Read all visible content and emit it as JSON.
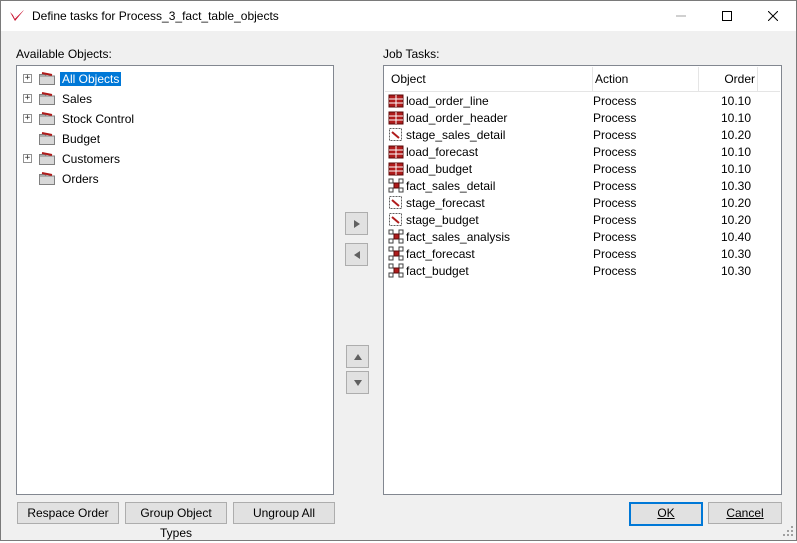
{
  "window": {
    "title": "Define tasks for Process_3_fact_table_objects"
  },
  "left_panel": {
    "label": "Available Objects:",
    "items": [
      {
        "label": "All Objects",
        "selected": true,
        "expandable": true
      },
      {
        "label": "Sales",
        "selected": false,
        "expandable": true
      },
      {
        "label": "Stock Control",
        "selected": false,
        "expandable": true
      },
      {
        "label": "Budget",
        "selected": false,
        "expandable": false
      },
      {
        "label": "Customers",
        "selected": false,
        "expandable": true
      },
      {
        "label": "Orders",
        "selected": false,
        "expandable": false
      }
    ]
  },
  "right_panel": {
    "label": "Job Tasks:",
    "columns": {
      "object": "Object",
      "action": "Action",
      "order": "Order"
    },
    "rows": [
      {
        "object": "load_order_line",
        "action": "Process",
        "order": "10.10",
        "icon": "load-table-icon"
      },
      {
        "object": "load_order_header",
        "action": "Process",
        "order": "10.10",
        "icon": "load-table-icon"
      },
      {
        "object": "stage_sales_detail",
        "action": "Process",
        "order": "10.20",
        "icon": "stage-table-icon"
      },
      {
        "object": "load_forecast",
        "action": "Process",
        "order": "10.10",
        "icon": "load-table-icon"
      },
      {
        "object": "load_budget",
        "action": "Process",
        "order": "10.10",
        "icon": "load-table-icon"
      },
      {
        "object": "fact_sales_detail",
        "action": "Process",
        "order": "10.30",
        "icon": "fact-table-icon"
      },
      {
        "object": "stage_forecast",
        "action": "Process",
        "order": "10.20",
        "icon": "stage-table-icon"
      },
      {
        "object": "stage_budget",
        "action": "Process",
        "order": "10.20",
        "icon": "stage-table-icon"
      },
      {
        "object": "fact_sales_analysis",
        "action": "Process",
        "order": "10.40",
        "icon": "fact-table-icon"
      },
      {
        "object": "fact_forecast",
        "action": "Process",
        "order": "10.30",
        "icon": "fact-table-icon"
      },
      {
        "object": "fact_budget",
        "action": "Process",
        "order": "10.30",
        "icon": "fact-table-icon"
      }
    ]
  },
  "buttons": {
    "respace_order": "Respace Order",
    "group_object_types": "Group Object Types",
    "ungroup_all": "Ungroup All",
    "ok": "OK",
    "cancel": "Cancel"
  },
  "colors": {
    "accent": "#0078d7",
    "icon_red": "#b01c1c"
  }
}
